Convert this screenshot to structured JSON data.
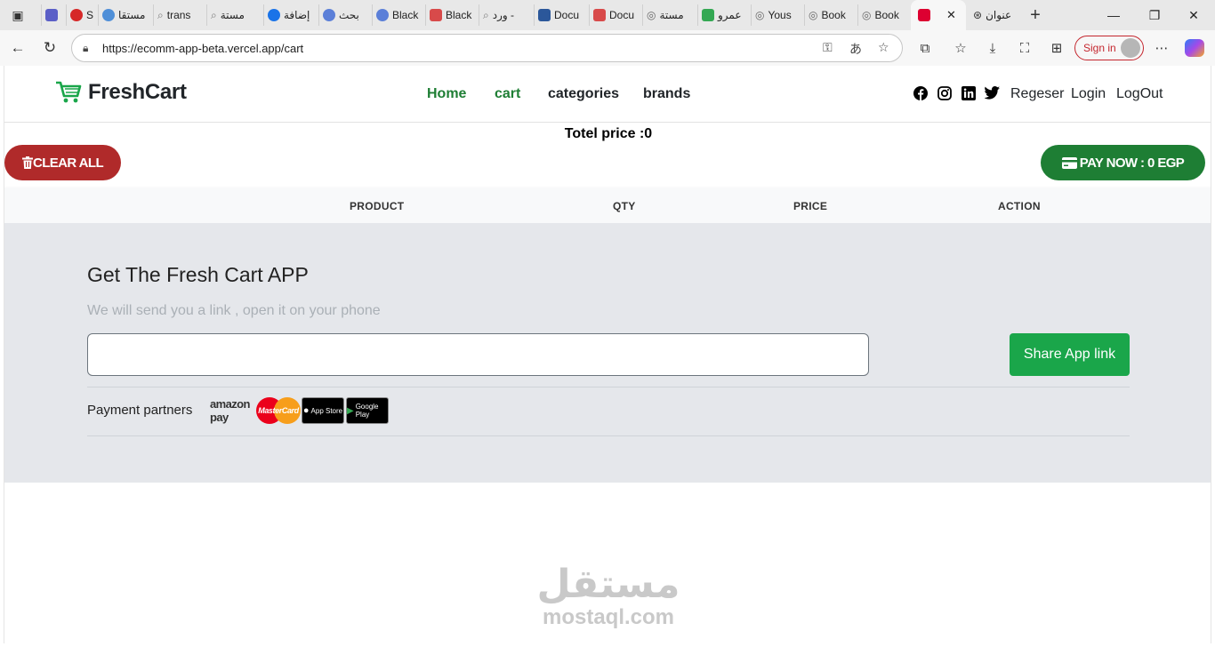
{
  "browser": {
    "tabs": [
      {
        "label": "",
        "color": "#5b5fc7"
      },
      {
        "label": "",
        "color": "#d62828"
      },
      {
        "label": "S",
        "color": "#d62828"
      },
      {
        "label": "مستقا",
        "color": "#4f8fd8"
      },
      {
        "label": "trans",
        "color": "#888888"
      },
      {
        "label": "مستة",
        "color": "#888888"
      },
      {
        "label": "إضافة",
        "color": "#1a73e8"
      },
      {
        "label": "بحث",
        "color": "#5b7fd8"
      },
      {
        "label": "Black",
        "color": "#5b7fd8"
      },
      {
        "label": "Black",
        "color": "#d84a4a"
      },
      {
        "label": "ورد -",
        "color": "#888888"
      },
      {
        "label": "Docu",
        "color": "#2b579a"
      },
      {
        "label": "Docu",
        "color": "#d84a4a"
      },
      {
        "label": "مستة",
        "color": "#666666"
      },
      {
        "label": "عمرو",
        "color": "#34a853"
      },
      {
        "label": "Yous",
        "color": "#666666"
      },
      {
        "label": "Book",
        "color": "#666666"
      },
      {
        "label": "Book",
        "color": "#666666"
      },
      {
        "label": "",
        "color": "#dd0031"
      },
      {
        "label": "عنوان",
        "color": "#333333"
      }
    ],
    "close_tab_symbol": "✕",
    "new_tab_symbol": "+",
    "url": "https://ecomm-app-beta.vercel.app/cart",
    "signin_label": "Sign in"
  },
  "site": {
    "brand": "FreshCart",
    "nav_links": [
      "Home",
      "cart",
      "categories",
      "brands"
    ],
    "auth_links": [
      "Regeser",
      "Login",
      "LogOut"
    ],
    "social_icons": [
      "facebook-icon",
      "instagram-icon",
      "linkedin-icon",
      "twitter-icon"
    ]
  },
  "cart": {
    "total_label": "Totel price :0",
    "clear_label": "CLEAR ALL",
    "pay_label": "PAY NOW : 0 EGP",
    "columns": [
      "PRODUCT",
      "QTY",
      "PRICE",
      "ACTION"
    ]
  },
  "footer": {
    "title": "Get The Fresh Cart APP",
    "subtitle": "We will send you a link , open it on your phone",
    "input_value": "",
    "share_label": "Share App link",
    "partners_label": "Payment partners",
    "logos": {
      "amazon": "amazon pay",
      "mastercard": "MasterCard",
      "appstore": "App Store",
      "googleplay": "Google Play"
    }
  },
  "watermark": {
    "arabic": "مستقل",
    "latin": "mostaql.com"
  },
  "colors": {
    "green": "#1e7e34",
    "red": "#b02a2a",
    "footer_bg": "#e5e7eb",
    "share_green": "#1aa64a"
  }
}
